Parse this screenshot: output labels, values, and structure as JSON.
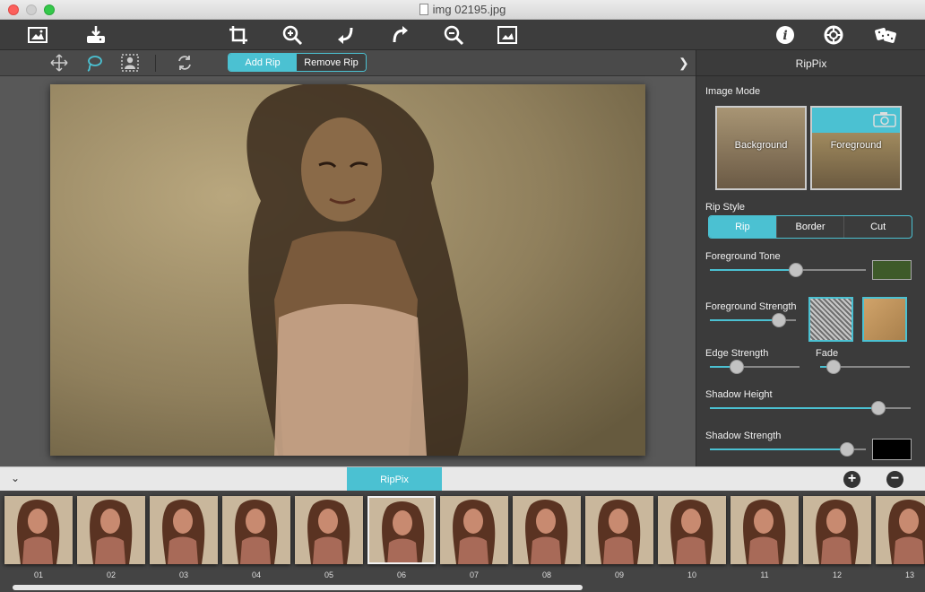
{
  "window": {
    "title": "img 02195.jpg"
  },
  "toolbar": {
    "buttons": [
      {
        "name": "open-image-icon"
      },
      {
        "name": "save-download-icon"
      },
      {
        "name": "crop-icon"
      },
      {
        "name": "zoom-in-icon"
      },
      {
        "name": "rotate-left-icon"
      },
      {
        "name": "rotate-right-icon"
      },
      {
        "name": "zoom-out-icon"
      },
      {
        "name": "fit-image-icon"
      },
      {
        "name": "info-icon"
      },
      {
        "name": "help-icon"
      },
      {
        "name": "dice-random-icon"
      }
    ]
  },
  "subbar": {
    "tools": [
      "move-icon",
      "lasso-icon",
      "person-select-icon",
      "refresh-icon"
    ],
    "add_rip": "Add Rip",
    "remove_rip": "Remove Rip"
  },
  "panel": {
    "title": "RipPix",
    "image_mode_label": "Image Mode",
    "mode_background": "Background",
    "mode_foreground": "Foreground",
    "rip_style_label": "Rip Style",
    "styles": [
      "Rip",
      "Border",
      "Cut"
    ],
    "selected_style": "Rip",
    "foreground_tone_label": "Foreground Tone",
    "foreground_tone_value": 0.55,
    "foreground_tone_color": "#3e5a2a",
    "foreground_strength_label": "Foreground Strength",
    "foreground_strength_value": 0.8,
    "edge_strength_label": "Edge Strength",
    "edge_strength_value": 0.3,
    "fade_label": "Fade",
    "fade_value": 0.15,
    "shadow_height_label": "Shadow Height",
    "shadow_height_value": 0.84,
    "shadow_strength_label": "Shadow Strength",
    "shadow_strength_value": 0.88,
    "shadow_color": "#000000"
  },
  "filmstrip": {
    "tab": "RipPix",
    "items": [
      "01",
      "02",
      "03",
      "04",
      "05",
      "06",
      "07",
      "08",
      "09",
      "10",
      "11",
      "12",
      "13"
    ],
    "selected": "06"
  },
  "colors": {
    "accent": "#4bc1d2"
  }
}
